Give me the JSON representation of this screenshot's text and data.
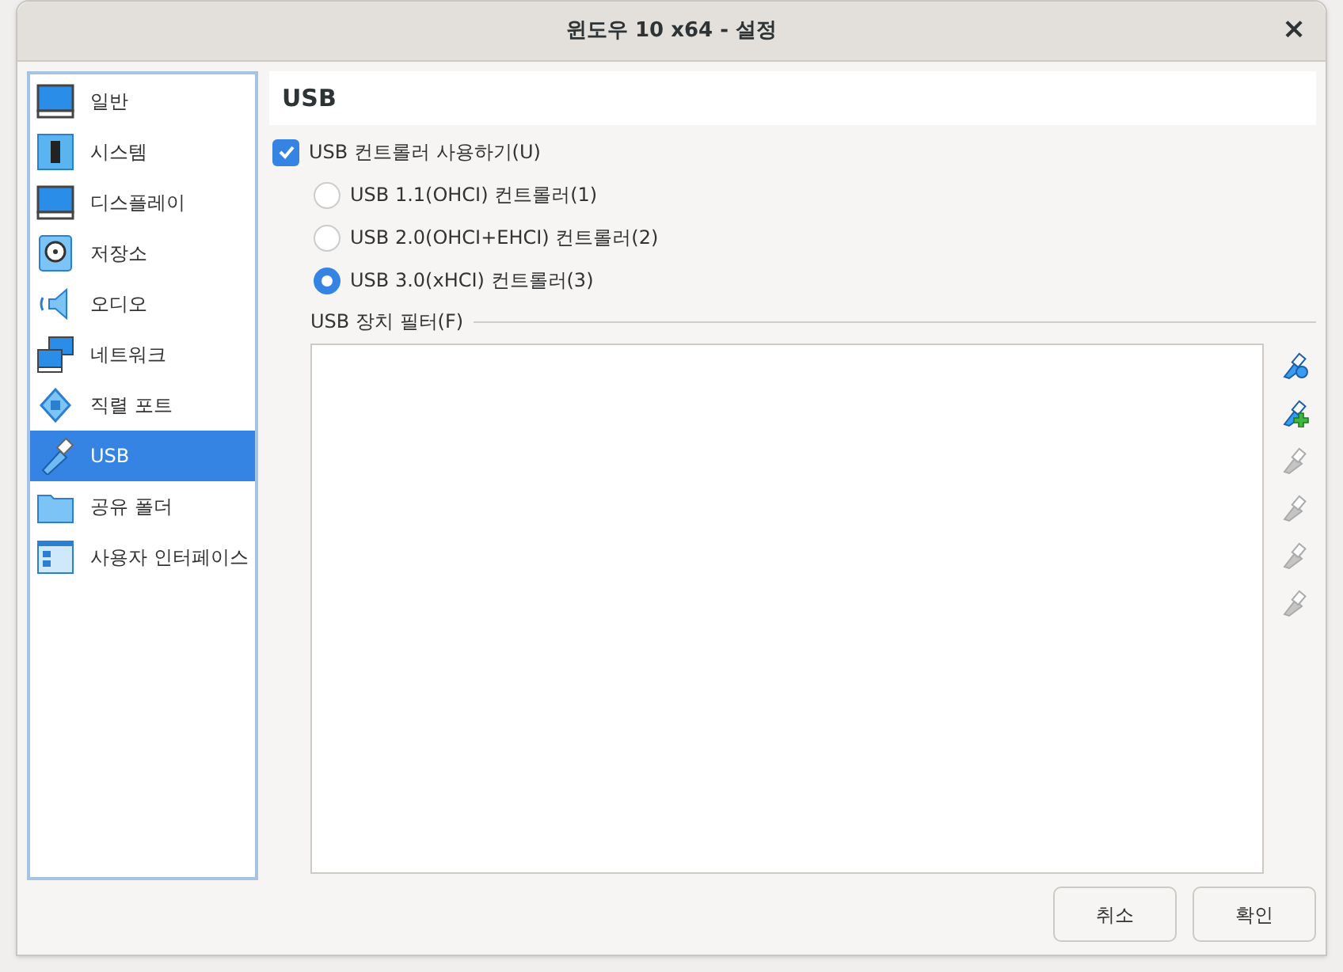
{
  "window": {
    "title": "윈도우 10 x64 - 설정",
    "close": "×"
  },
  "sidebar": {
    "items": [
      {
        "label": "일반",
        "kind": "monitor",
        "selected": false
      },
      {
        "label": "시스템",
        "kind": "chip",
        "selected": false
      },
      {
        "label": "디스플레이",
        "kind": "monitor",
        "selected": false
      },
      {
        "label": "저장소",
        "kind": "disk",
        "selected": false
      },
      {
        "label": "오디오",
        "kind": "speaker",
        "selected": false
      },
      {
        "label": "네트워크",
        "kind": "network",
        "selected": false
      },
      {
        "label": "직렬 포트",
        "kind": "serial",
        "selected": false
      },
      {
        "label": "USB",
        "kind": "usb",
        "selected": true
      },
      {
        "label": "공유 폴더",
        "kind": "folder",
        "selected": false
      },
      {
        "label": "사용자 인터페이스",
        "kind": "window",
        "selected": false
      }
    ]
  },
  "page": {
    "title": "USB",
    "enable": {
      "label": "USB 컨트롤러 사용하기(U)",
      "checked": true
    },
    "controllers": [
      {
        "label": "USB 1.1(OHCI) 컨트롤러(1)",
        "selected": false
      },
      {
        "label": "USB 2.0(OHCI+EHCI) 컨트롤러(2)",
        "selected": false
      },
      {
        "label": "USB 3.0(xHCI) 컨트롤러(3)",
        "selected": true
      }
    ],
    "filters": {
      "label": "USB 장치 필터(F)"
    },
    "tools": [
      {
        "kind": "add",
        "disabled": false
      },
      {
        "kind": "add-device",
        "disabled": false
      },
      {
        "kind": "edit",
        "disabled": true
      },
      {
        "kind": "remove",
        "disabled": true
      },
      {
        "kind": "up",
        "disabled": true
      },
      {
        "kind": "down",
        "disabled": true
      }
    ]
  },
  "buttons": [
    "취소",
    "확인"
  ]
}
